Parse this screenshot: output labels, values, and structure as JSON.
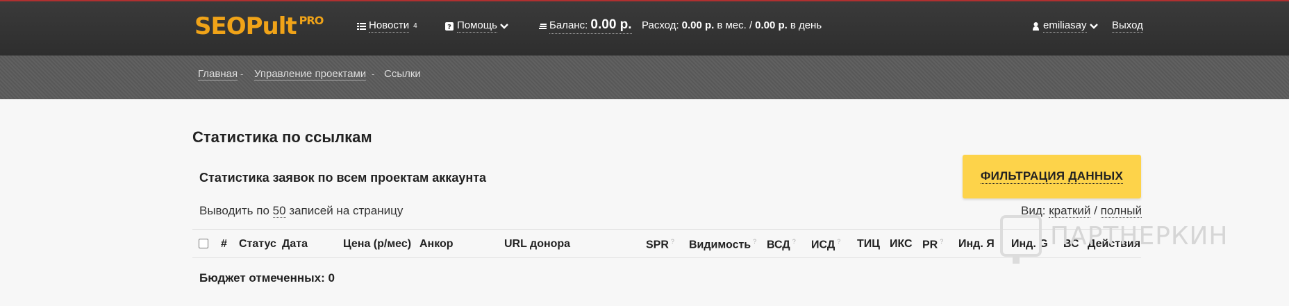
{
  "header": {
    "logo_main": "SEOPult",
    "logo_suffix": "PRO",
    "news_label": "Новости",
    "news_count": "4",
    "help_label": "Помощь",
    "balance_label": "Баланс:",
    "balance_value": "0.00 р.",
    "spend_prefix": "Расход:",
    "spend_month_value": "0.00 р.",
    "spend_month_suffix": "в мес. /",
    "spend_day_value": "0.00 р.",
    "spend_day_suffix": "в день",
    "username": "emiliasay",
    "logout_label": "Выход"
  },
  "breadcrumb": {
    "items": [
      "Главная",
      "Управление проектами",
      "Ссылки"
    ],
    "separator": "-"
  },
  "main": {
    "title": "Статистика по ссылкам",
    "subtitle": "Статистика заявок по всем проектам аккаунта",
    "filter_button": "ФИЛЬТРАЦИЯ ДАННЫХ",
    "perpage_prefix": "Выводить по",
    "perpage_value": "50",
    "perpage_suffix": "записей на страницу",
    "view_label": "Вид:",
    "view_short": "краткий",
    "view_sep": "/",
    "view_full": "полный",
    "columns": [
      "#",
      "Статус",
      "Дата",
      "Цена (р/мес)",
      "Анкор",
      "URL донора",
      "SPR",
      "Видимость",
      "ВСД",
      "ИСД",
      "ТИЦ",
      "ИКС",
      "PR",
      "Инд. Я",
      "Инд. G",
      "ВС",
      "Действия"
    ],
    "help_mark": "?",
    "budget_label": "Бюджет отмеченных: 0"
  },
  "watermark": {
    "text": "ПАРТНЕРКИН"
  },
  "colors": {
    "accent": "#fdd34a",
    "logo": "#f0a318",
    "header_bg": "#333333"
  }
}
